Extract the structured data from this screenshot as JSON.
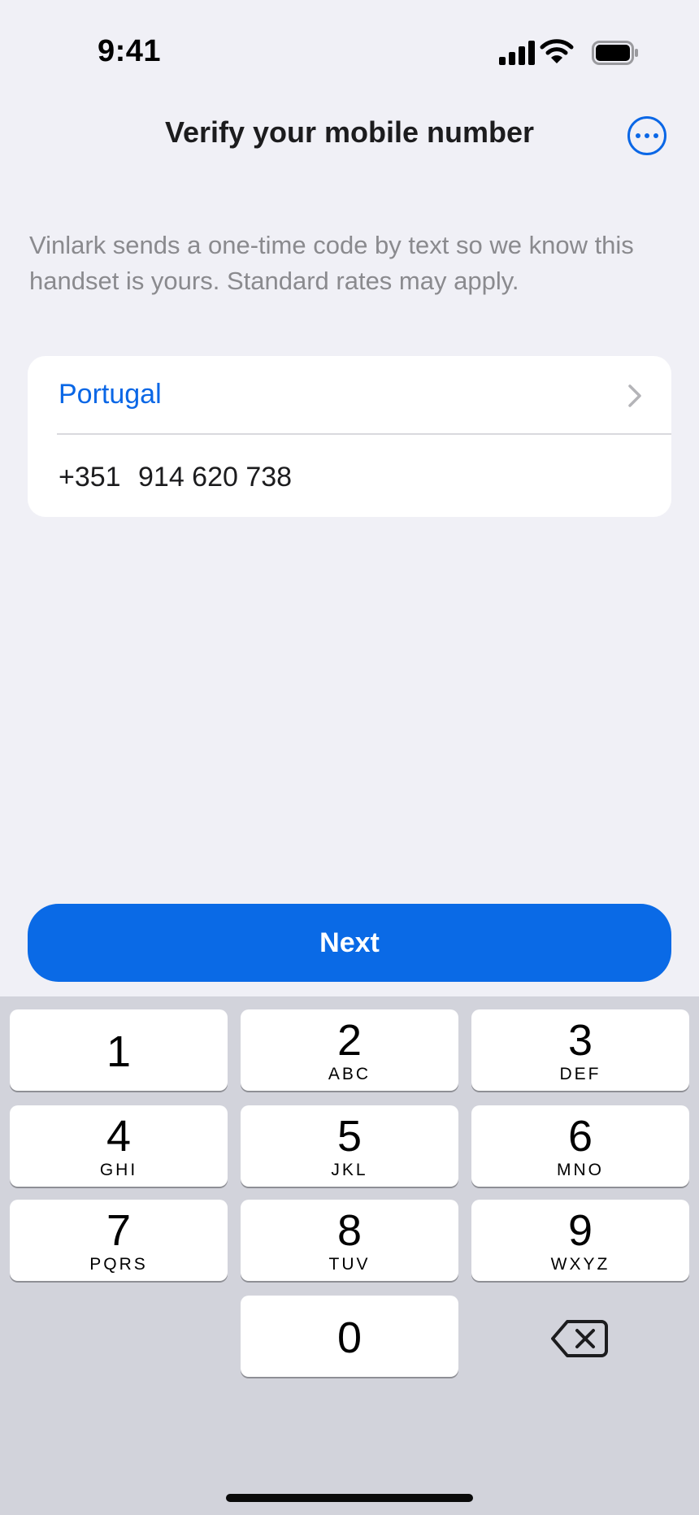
{
  "status_bar": {
    "time": "9:41",
    "icons": [
      "signal-icon",
      "wifi-icon",
      "battery-icon"
    ]
  },
  "header": {
    "title": "Verify your mobile number",
    "more_icon": "ellipsis-circle-icon"
  },
  "description": "Vinlark sends a one-time code by text so we know this handset is yours. Standard rates may apply.",
  "form": {
    "country": "Portugal",
    "country_code": "+351",
    "phone_number": "914 620 738"
  },
  "actions": {
    "next_label": "Next"
  },
  "keypad": {
    "keys": [
      {
        "digit": "1",
        "letters": ""
      },
      {
        "digit": "2",
        "letters": "ABC"
      },
      {
        "digit": "3",
        "letters": "DEF"
      },
      {
        "digit": "4",
        "letters": "GHI"
      },
      {
        "digit": "5",
        "letters": "JKL"
      },
      {
        "digit": "6",
        "letters": "MNO"
      },
      {
        "digit": "7",
        "letters": "PQRS"
      },
      {
        "digit": "8",
        "letters": "TUV"
      },
      {
        "digit": "9",
        "letters": "WXYZ"
      },
      {
        "digit": "0",
        "letters": ""
      }
    ],
    "delete_icon": "backspace-icon"
  },
  "colors": {
    "accent": "#0a6ae6",
    "background": "#f0f0f6",
    "keypad_background": "#d2d3db"
  }
}
